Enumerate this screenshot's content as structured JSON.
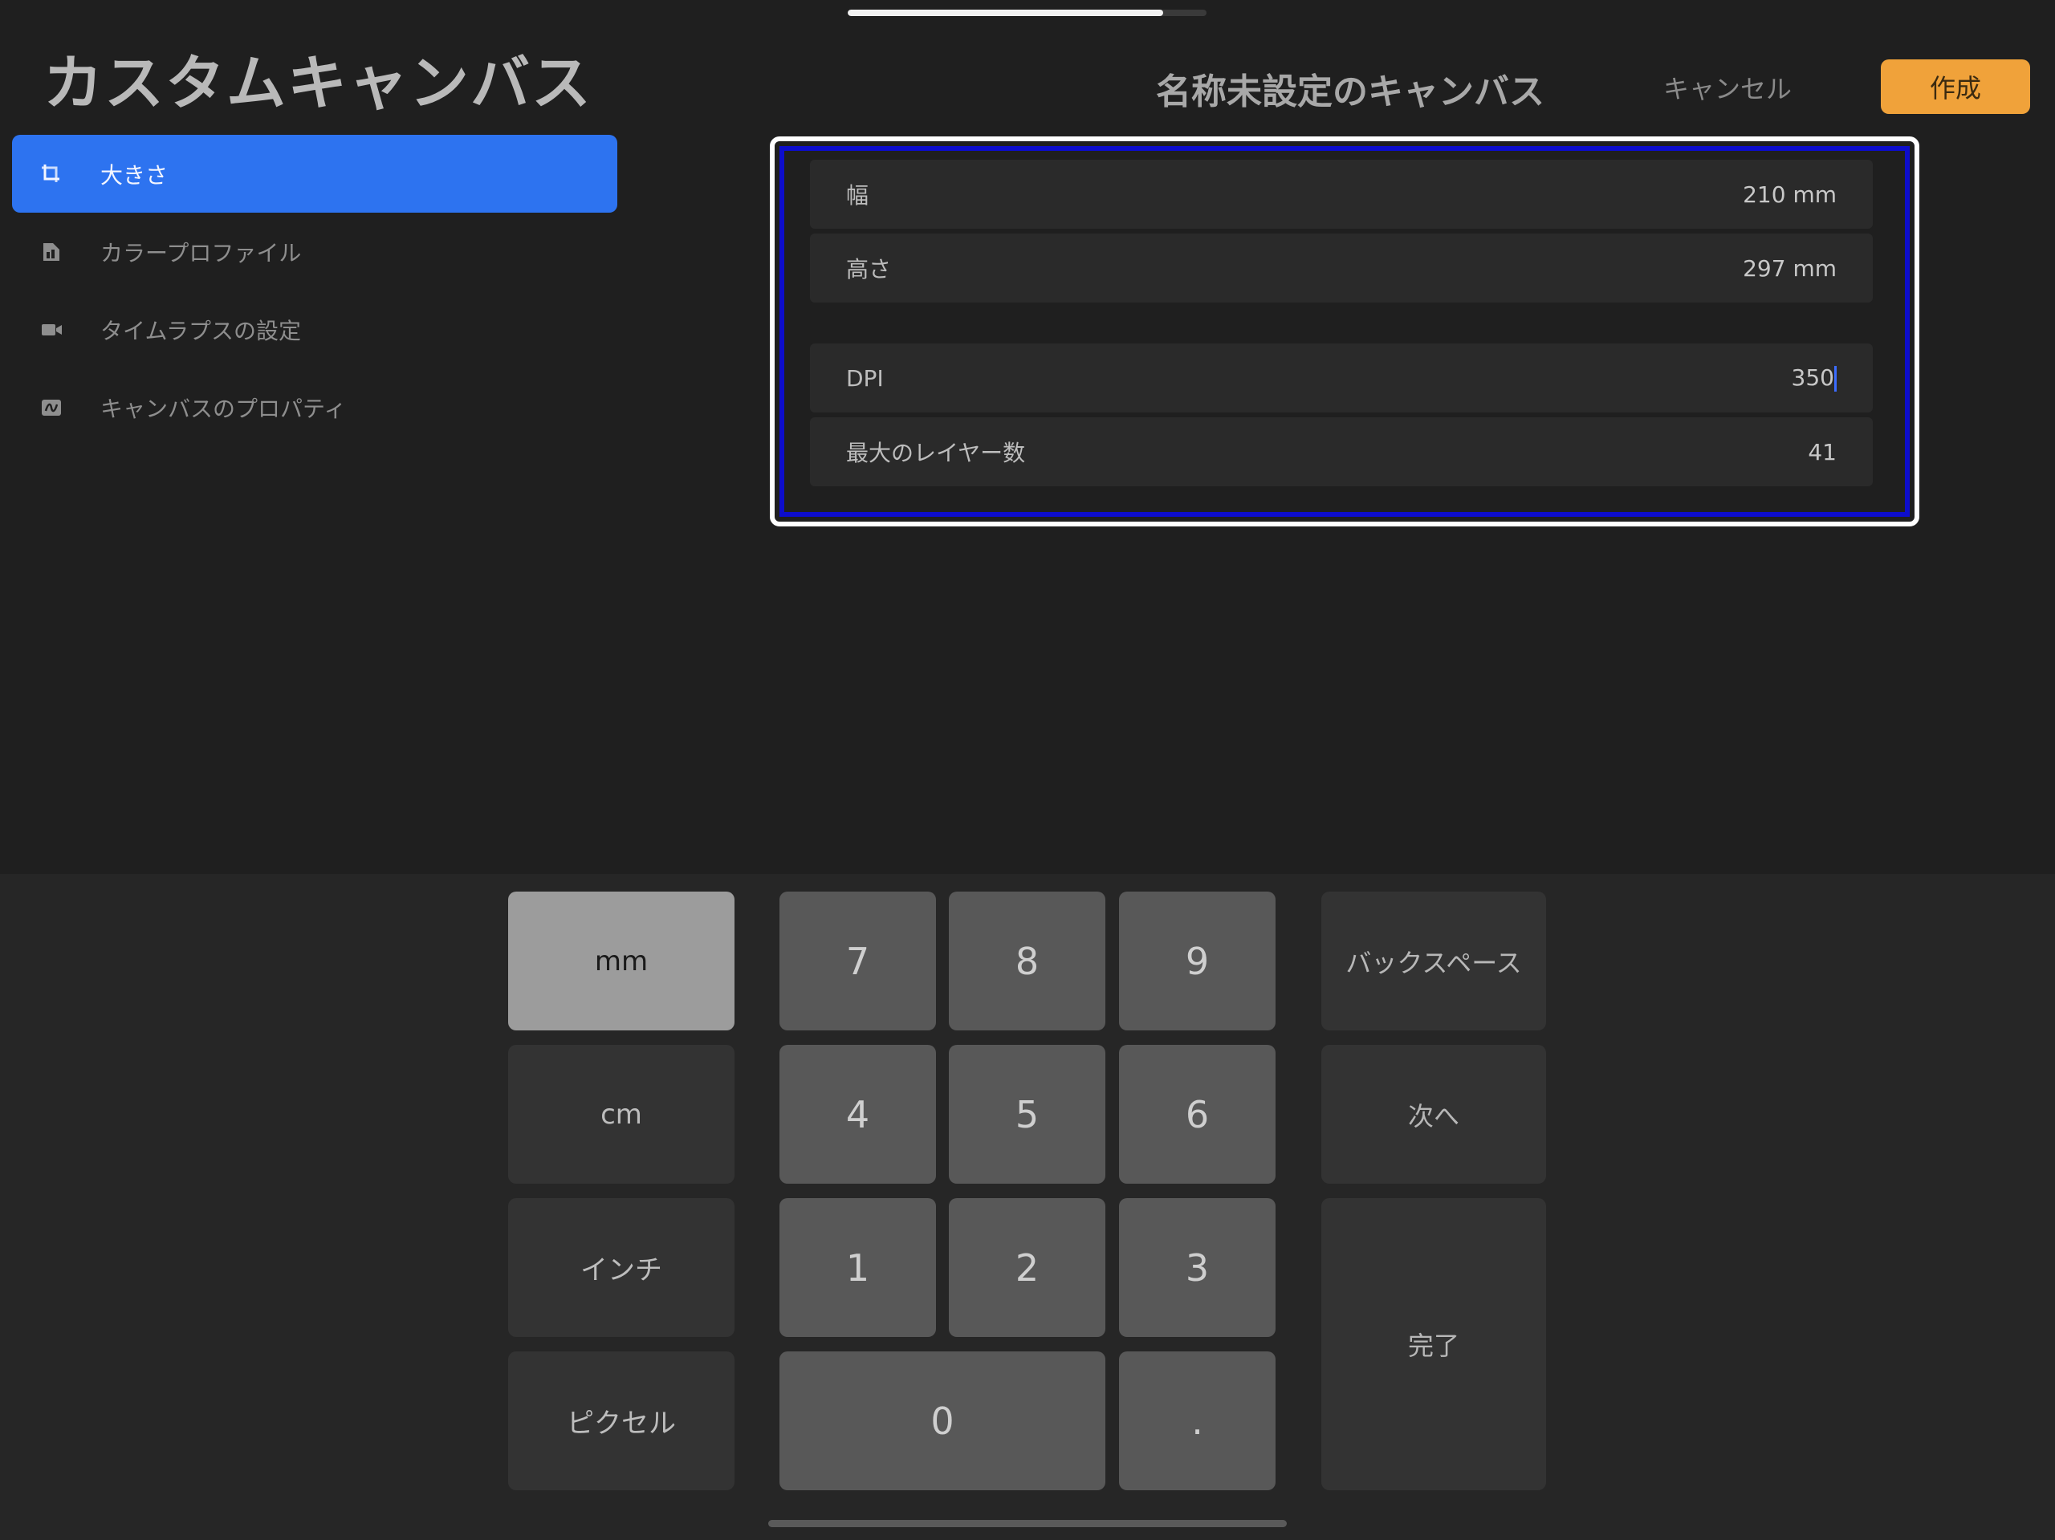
{
  "progress": {
    "fraction": 0.88
  },
  "page_title": "カスタムキャンバス",
  "sidebar": {
    "items": [
      {
        "label": "大きさ",
        "icon": "crop-size-icon",
        "active": true
      },
      {
        "label": "カラープロファイル",
        "icon": "color-profile-icon",
        "active": false
      },
      {
        "label": "タイムラプスの設定",
        "icon": "video-camera-icon",
        "active": false
      },
      {
        "label": "キャンバスのプロパティ",
        "icon": "canvas-properties-icon",
        "active": false
      }
    ]
  },
  "header": {
    "canvas_title": "名称未設定のキャンバス",
    "cancel_label": "キャンセル",
    "create_label": "作成"
  },
  "fields": [
    {
      "label": "幅",
      "value": "210 mm"
    },
    {
      "label": "高さ",
      "value": "297 mm"
    },
    {
      "label": "DPI",
      "value": "350"
    },
    {
      "label": "最大のレイヤー数",
      "value": "41"
    }
  ],
  "keyboard": {
    "units": [
      "mm",
      "cm",
      "インチ",
      "ピクセル"
    ],
    "selected_unit": "mm",
    "digits": [
      "7",
      "8",
      "9",
      "4",
      "5",
      "6",
      "1",
      "2",
      "3",
      "0",
      "."
    ],
    "backspace_label": "バックスペース",
    "next_label": "次へ",
    "done_label": "完了"
  },
  "colors": {
    "accent_blue": "#2d73f0",
    "create_orange": "#f0a23a",
    "focus_ring": "#0d0dcc",
    "background": "#1f1f1f"
  }
}
